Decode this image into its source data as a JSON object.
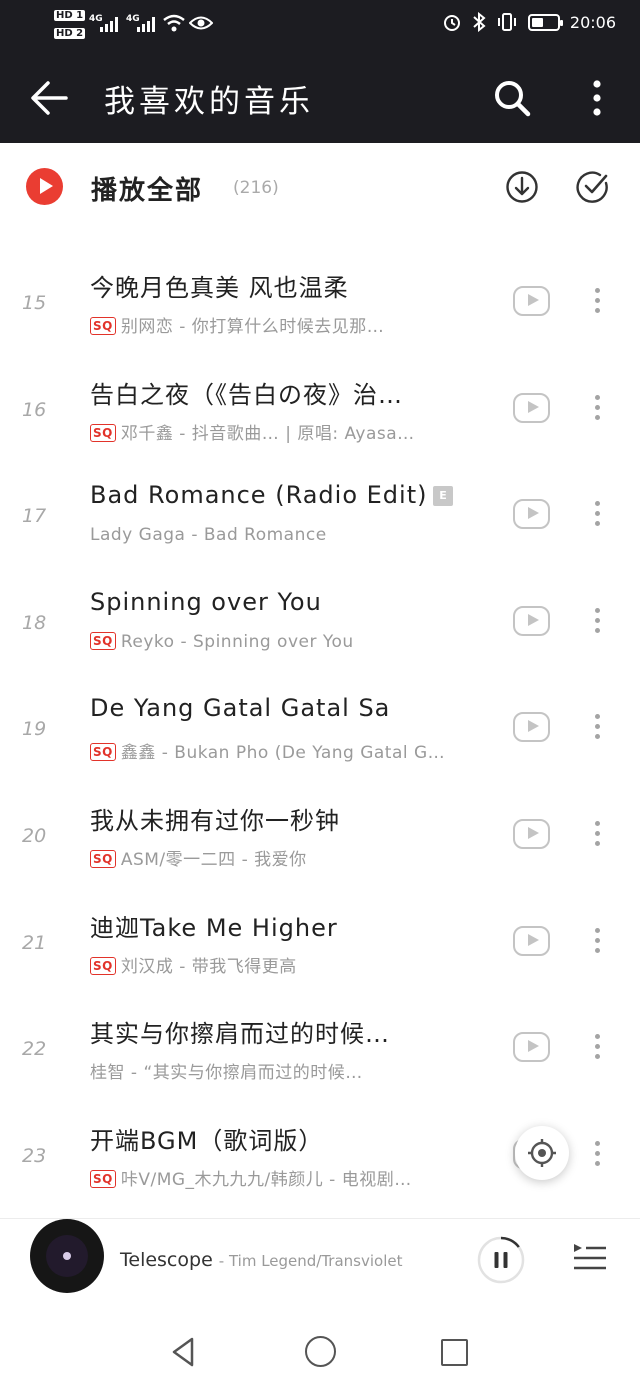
{
  "status_bar": {
    "sim1": "HD 1",
    "sim2": "HD 2",
    "net1": "4G",
    "net2": "4G",
    "time": "20:06",
    "battery_level": 0.45
  },
  "toolbar": {
    "title": "我喜欢的音乐",
    "icons": [
      "back-arrow-icon",
      "search-icon",
      "more-vertical-icon"
    ]
  },
  "play_all": {
    "label": "播放全部",
    "count": "(216)",
    "icons": [
      "play-icon",
      "download-icon",
      "multi-select-check-icon"
    ]
  },
  "songs": [
    {
      "index": "15",
      "title": "今晚月色真美 风也温柔",
      "subtitle": "别网恋 - 你打算什么时候去见那…",
      "sq": true,
      "explicit": false
    },
    {
      "index": "16",
      "title": "告白之夜（《告白の夜》治…",
      "subtitle": "邓千鑫 - 抖音歌曲… | 原唱: Ayasa…",
      "sq": true,
      "explicit": false
    },
    {
      "index": "17",
      "title": "Bad Romance (Radio Edit)",
      "subtitle": "Lady Gaga - Bad Romance",
      "sq": false,
      "explicit": true
    },
    {
      "index": "18",
      "title": "Spinning over You",
      "subtitle": "Reyko - Spinning over You",
      "sq": true,
      "explicit": false
    },
    {
      "index": "19",
      "title": "De Yang Gatal Gatal Sa",
      "subtitle": "鑫鑫 - Bukan Pho (De Yang Gatal G…",
      "sq": true,
      "explicit": false
    },
    {
      "index": "20",
      "title": "我从未拥有过你一秒钟",
      "subtitle": "ASM/零一二四 - 我爱你",
      "sq": true,
      "explicit": false
    },
    {
      "index": "21",
      "title": "迪迦Take Me Higher",
      "subtitle": "刘汉成 - 带我飞得更高",
      "sq": true,
      "explicit": false
    },
    {
      "index": "22",
      "title": "其实与你擦肩而过的时候…",
      "subtitle": "桂智 - “其实与你擦肩而过的时候…",
      "sq": false,
      "explicit": false
    },
    {
      "index": "23",
      "title": "开端BGM（歌词版）",
      "subtitle": "咔V/MG_木九九九/韩颜儿 - 电视剧…",
      "sq": true,
      "explicit": false
    }
  ],
  "badges": {
    "sq": "SQ",
    "explicit": "E"
  },
  "now_playing": {
    "title": "Telescope",
    "artist": "- Tim Legend/Transviolet",
    "progress": 0.15
  },
  "colors": {
    "header_bg": "#1c1c21",
    "accent_red": "#ea3d32",
    "muted_text": "#9a9a9a"
  }
}
